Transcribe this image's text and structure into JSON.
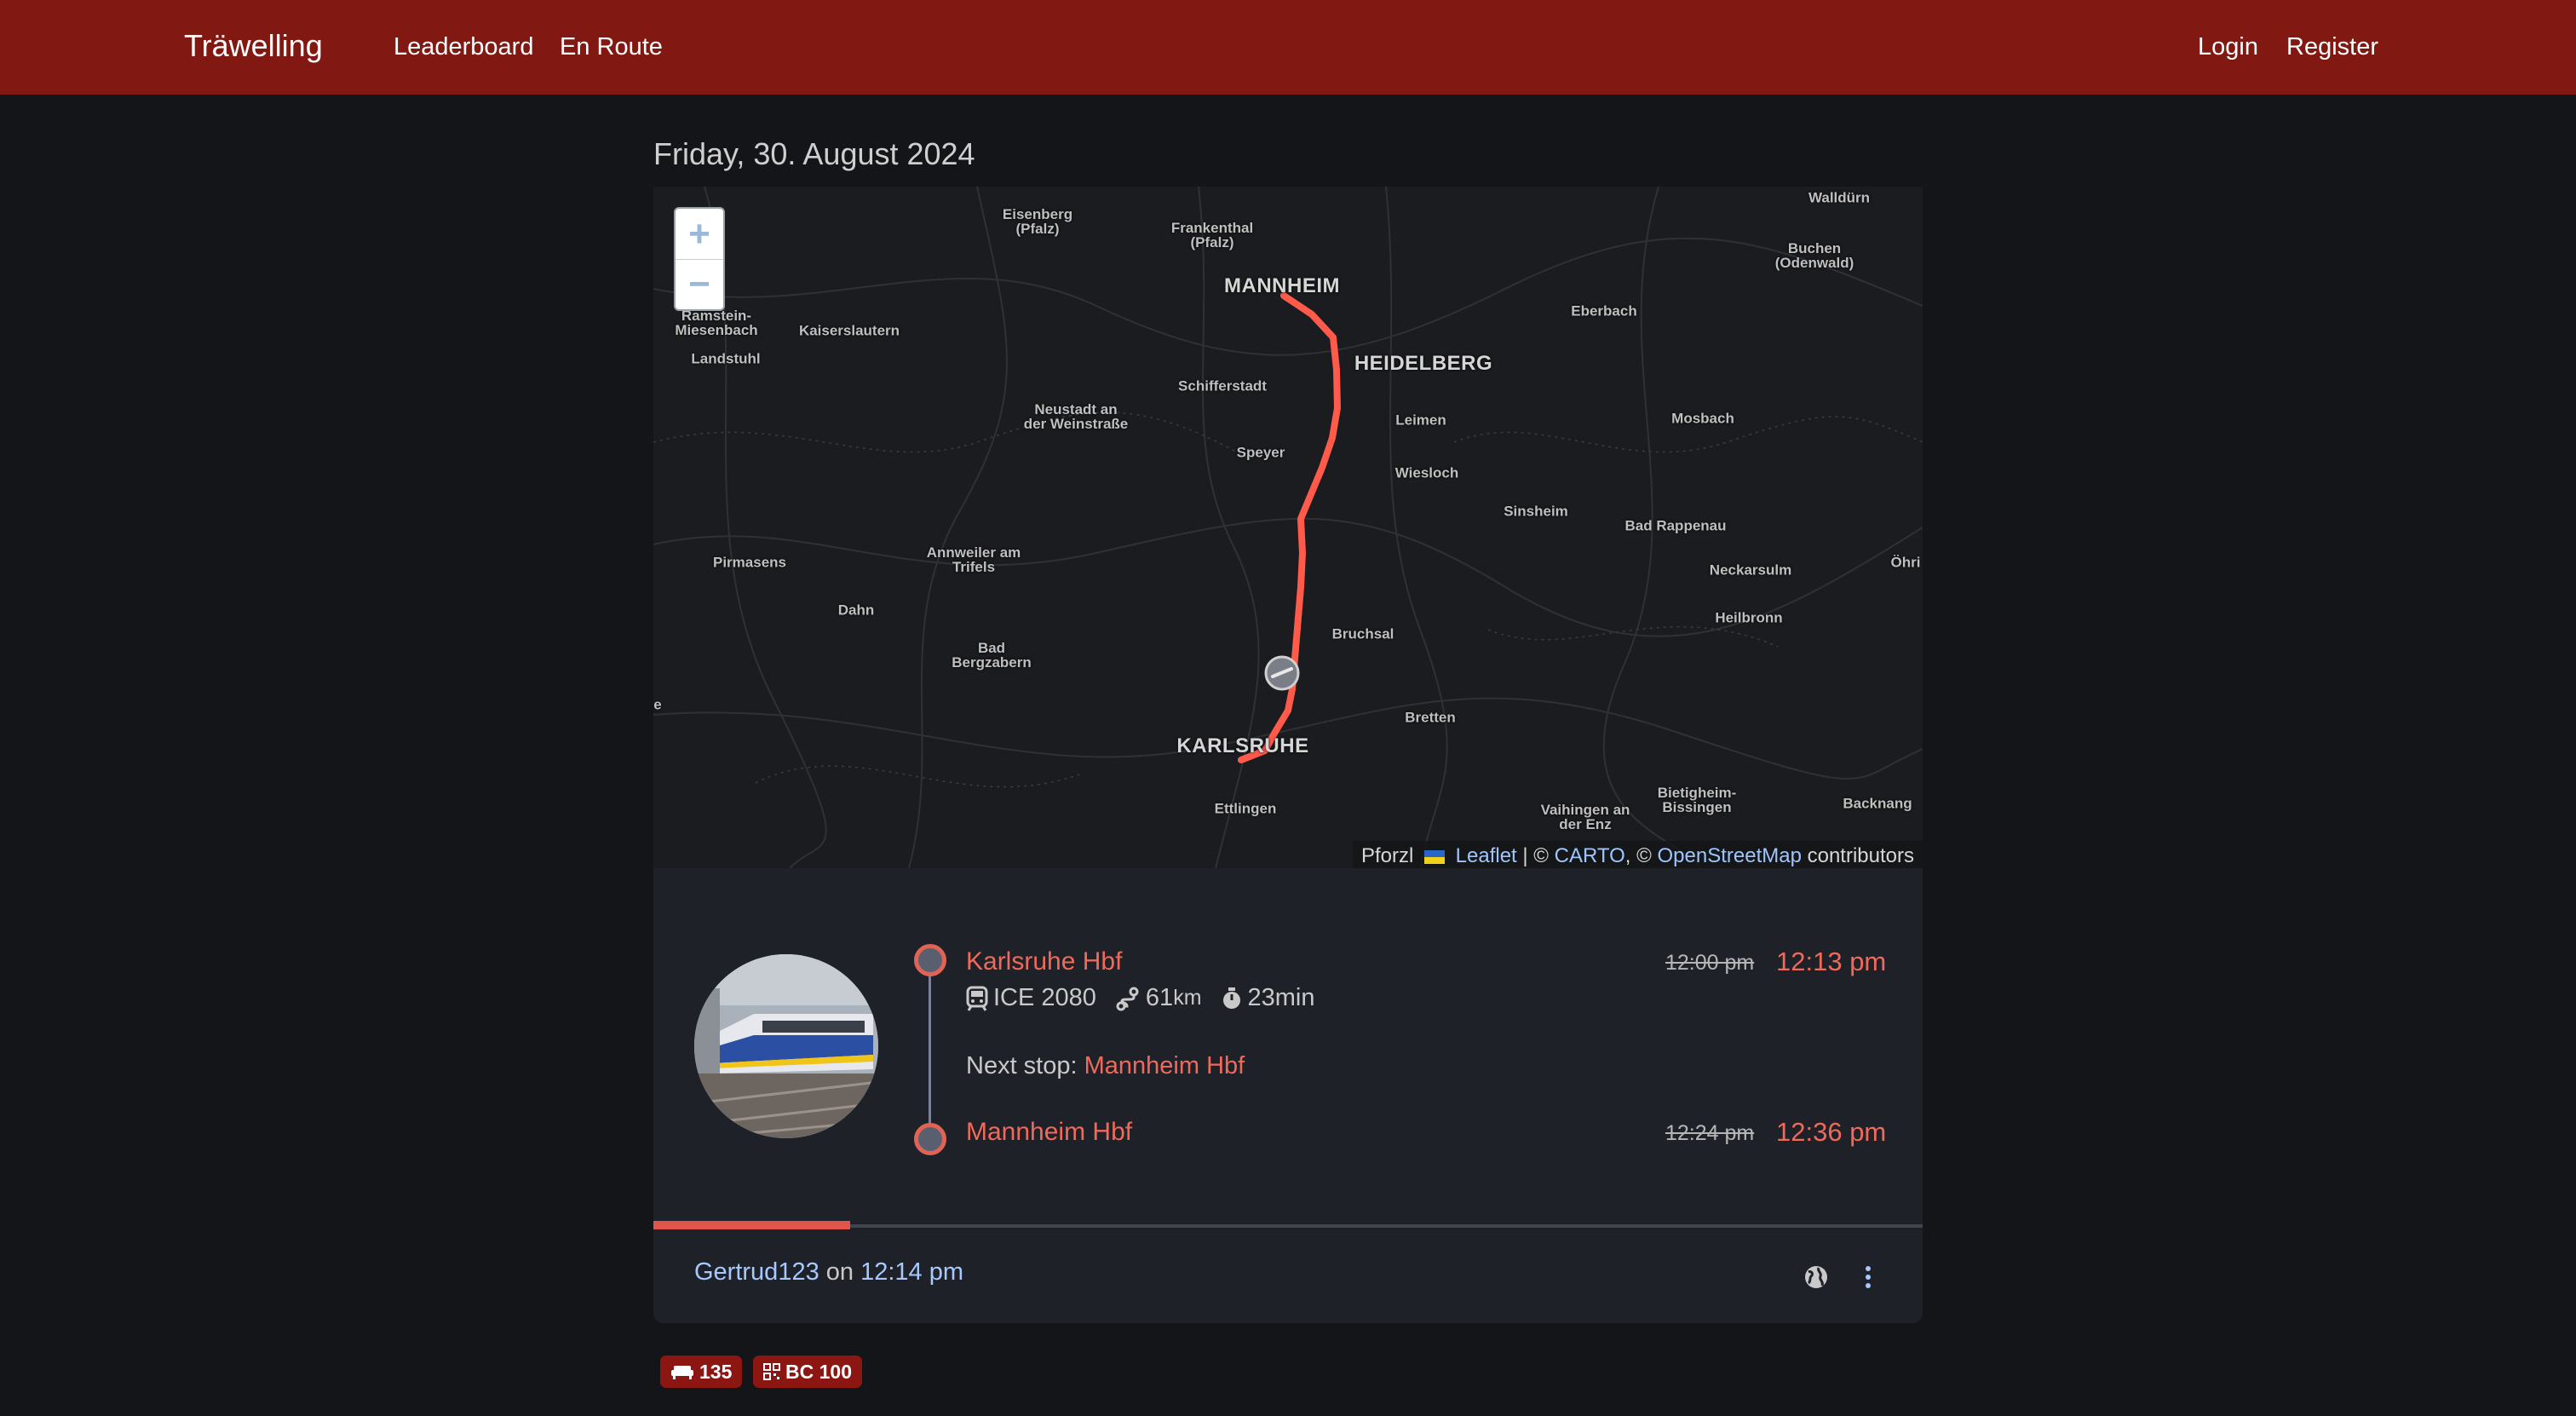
{
  "navbar": {
    "brand": "Träwelling",
    "links": [
      "Leaderboard",
      "En Route"
    ],
    "login": "Login",
    "register": "Register"
  },
  "date_heading": "Friday, 30. August 2024",
  "map": {
    "zoom_in": "+",
    "zoom_out": "−",
    "labels": {
      "walldurn": "Walldürn",
      "eisenberg": "Eisenberg\n(Pfalz)",
      "frankenthal": "Frankenthal\n(Pfalz)",
      "buchen": "Buchen\n(Odenwald)",
      "mannheim": "MANNHEIM",
      "eberbach": "Eberbach",
      "ramstein": "Ramstein-\nMiesenbach",
      "kaiserslautern": "Kaiserslautern",
      "heidelberg": "HEIDELBERG",
      "landstuhl": "Landstuhl",
      "schifferstadt": "Schifferstadt",
      "neustadt": "Neustadt an\nder Weinstraße",
      "leimen": "Leimen",
      "mosbach": "Mosbach",
      "speyer": "Speyer",
      "wiesloch": "Wiesloch",
      "sinsheim": "Sinsheim",
      "bad_rappenau": "Bad Rappenau",
      "annweiler": "Annweiler am\nTrifels",
      "pirmasens": "Pirmasens",
      "neckarsulm": "Neckarsulm",
      "ohri": "Öhri",
      "dahn": "Dahn",
      "heilbronn": "Heilbronn",
      "bruchsal": "Bruchsal",
      "bad_bergzabern": "Bad\nBergzabern",
      "e": "e",
      "bretten": "Bretten",
      "karlsruhe": "KARLSRUHE",
      "ettlingen": "Ettlingen",
      "vaihingen": "Vaihingen an\nder Enz",
      "bietigheim": "Bietigheim-\nBissingen",
      "backnang": "Backnang"
    },
    "attribution": {
      "prefix": "Pforzl",
      "leaflet": "Leaflet",
      "sep1": "| ©",
      "carto": "CARTO",
      "sep2": ", ©",
      "osm": "OpenStreetMap",
      "suffix": "contributors"
    }
  },
  "status": {
    "origin": {
      "name": "Karlsruhe Hbf",
      "planned": "12:00 pm",
      "real": "12:13 pm"
    },
    "line": "ICE 2080",
    "distance": "61",
    "distance_unit": "km",
    "duration": "23min",
    "next_stop_label": "Next stop:",
    "next_stop": "Mannheim Hbf",
    "destination": {
      "name": "Mannheim Hbf",
      "planned": "12:24 pm",
      "real": "12:36 pm"
    },
    "progress_percent": 15.5,
    "user": "Gertrud123",
    "on": "on",
    "time": "12:14 pm",
    "visibility_icon": "globe-icon",
    "menu_icon": "kebab-menu-icon"
  },
  "badges": [
    {
      "icon": "couch-icon",
      "label": "135"
    },
    {
      "icon": "qrcode-icon",
      "label": "BC 100"
    }
  ],
  "colors": {
    "navbar": "#821812",
    "accent": "#ef6a5a",
    "route": "#ff5a4a",
    "link": "#a6c8ff",
    "background": "#141519",
    "card": "#1f2128"
  }
}
